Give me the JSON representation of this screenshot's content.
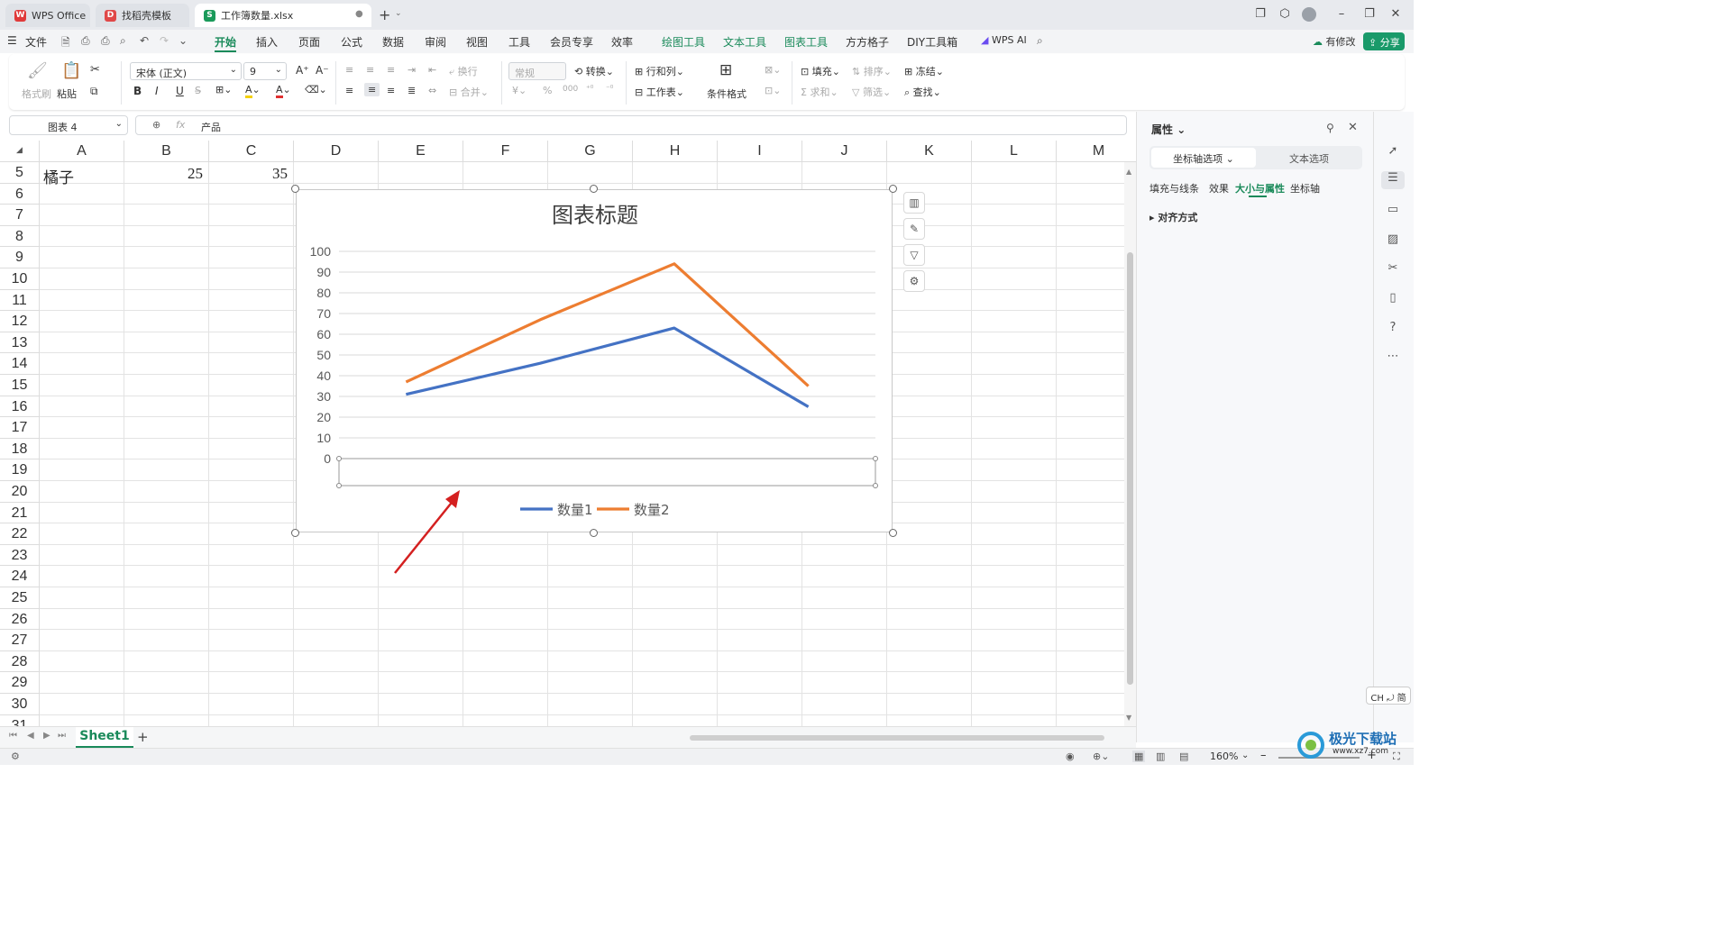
{
  "titlebar": {
    "tabs": [
      {
        "label": "WPS Office",
        "icon": "wps-logo-icon"
      },
      {
        "label": "找稻壳模板",
        "icon": "docer-icon"
      },
      {
        "label": "工作簿数量.xlsx",
        "icon": "spreadsheet-icon"
      }
    ],
    "new_tab": "+"
  },
  "menubar": {
    "file": "文件",
    "items": [
      "开始",
      "插入",
      "页面",
      "公式",
      "数据",
      "审阅",
      "视图",
      "工具",
      "会员专享",
      "效率"
    ],
    "context_items": [
      "绘图工具",
      "文本工具",
      "图表工具"
    ],
    "extra_items": [
      "方方格子",
      "DIY工具箱"
    ],
    "wps_ai": "WPS AI",
    "has_changes": "有修改",
    "share": "分享"
  },
  "ribbon": {
    "format_painter": "格式刷",
    "paste": "粘贴",
    "font_name": "宋体 (正文)",
    "font_size": "9",
    "bold": "B",
    "italic": "I",
    "underline": "U",
    "wrap": "换行",
    "merge": "合并",
    "number_format": "常规",
    "convert": "转换",
    "row_col": "行和列",
    "worksheet": "工作表",
    "cond_format": "条件格式",
    "fill": "填充",
    "sort": "排序",
    "freeze": "冻结",
    "sum": "求和",
    "filter": "筛选",
    "find": "查找"
  },
  "formula_bar": {
    "name_box": "图表 4",
    "fx": "fx",
    "content": "产品"
  },
  "grid": {
    "columns": [
      "A",
      "B",
      "C",
      "D",
      "E",
      "F",
      "G",
      "H",
      "I",
      "J",
      "K",
      "L",
      "M"
    ],
    "rows": [
      "5",
      "6",
      "7",
      "8",
      "9",
      "10",
      "11",
      "12",
      "13",
      "14",
      "15",
      "16",
      "17",
      "18",
      "19",
      "20",
      "21",
      "22",
      "23",
      "24",
      "25",
      "26",
      "27",
      "28",
      "29",
      "30",
      "31"
    ],
    "row5": {
      "a": "橘子",
      "b": "25",
      "c": "35"
    }
  },
  "chart_data": {
    "type": "line",
    "title": "图表标题",
    "xlabel": "",
    "ylabel": "",
    "ylim": [
      0,
      100
    ],
    "yticks": [
      "0",
      "10",
      "20",
      "30",
      "40",
      "50",
      "60",
      "70",
      "80",
      "90",
      "100"
    ],
    "x": [
      1,
      2,
      3,
      4
    ],
    "series": [
      {
        "name": "数量1",
        "values": [
          31,
          46,
          63,
          25
        ],
        "color": "#4472c4"
      },
      {
        "name": "数量2",
        "values": [
          37,
          67,
          94,
          35
        ],
        "color": "#ed7d31"
      }
    ],
    "grid": true,
    "legend": "bottom",
    "category_axis_labels": "empty (selected box)"
  },
  "annotation": {
    "arrow_color": "#d42020"
  },
  "panel": {
    "title": "属性",
    "tabs": [
      "坐标轴选项",
      "文本选项"
    ],
    "subtabs": [
      "填充与线条",
      "效果",
      "大小与属性",
      "坐标轴"
    ],
    "section": "对齐方式"
  },
  "sheetbar": {
    "sheet": "Sheet1",
    "add": "+"
  },
  "statusbar": {
    "zoom": "160%",
    "ime": "CH ⤾ 简"
  },
  "watermark": {
    "text": "极光下载站",
    "url": "www.xz7.com"
  }
}
